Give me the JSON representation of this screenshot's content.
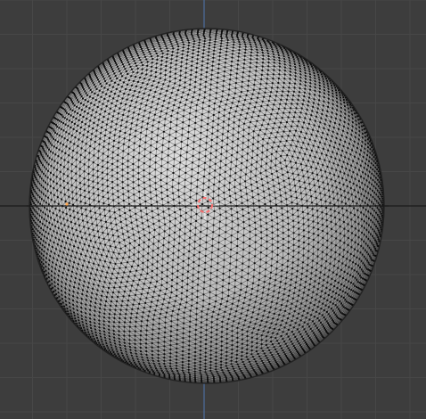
{
  "viewport": {
    "background_color": "#3d3d3d",
    "grid_minor_color": "#474747",
    "grid_major_color": "#4f4f4f",
    "x_axis_color": "#1b1b1b",
    "y_axis_color": "#4d6f9e"
  },
  "mesh": {
    "object_type": "icosphere",
    "edit_mode": true,
    "face_color": "#bdbdbd",
    "shade_color": "#6e6e6e",
    "highlight_color": "#dcdcdc",
    "wire_color": "#1a1a1a",
    "vertex_color": "#0d0d0d"
  },
  "cursor": {
    "icon": "3d-cursor-icon",
    "color_primary": "#ff6f6f",
    "color_secondary": "#ffffff"
  },
  "origin": {
    "icon": "object-origin-icon",
    "color": "#ffa64d"
  }
}
